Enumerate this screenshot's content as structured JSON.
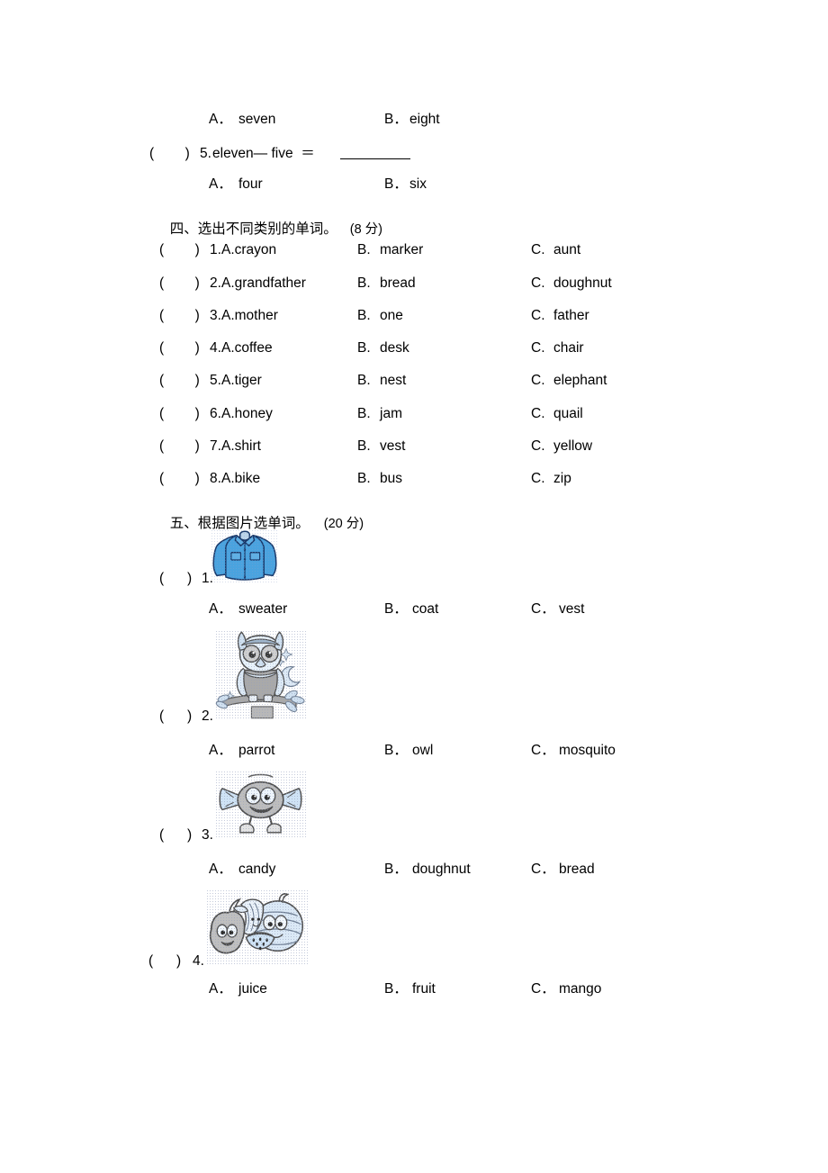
{
  "document": {
    "type": "english-exam-worksheet",
    "page_background": "#ffffff"
  },
  "carryover_question": {
    "options": {
      "a_label": "A．",
      "a_text": "seven",
      "b_label": "B．",
      "b_text": "eight"
    }
  },
  "question_5": {
    "paren": "(        )",
    "number": "5.",
    "stem": "eleven— five  ＝",
    "options": {
      "a_label": "A．",
      "a_text": "four",
      "b_label": "B．",
      "b_text": "six"
    }
  },
  "section_four": {
    "heading_cn": "四、选出不同类别的单词。",
    "score": "(8 分)",
    "paren": "(        )",
    "items": [
      {
        "num": "1.",
        "a": "A.crayon",
        "b_label": "B.",
        "b": "marker",
        "c_label": "C.",
        "c": "aunt"
      },
      {
        "num": "2.",
        "a": "A.grandfather",
        "b_label": "B.",
        "b": "bread",
        "c_label": "C.",
        "c": "doughnut"
      },
      {
        "num": "3.",
        "a": "A.mother",
        "b_label": "B.",
        "b": "one",
        "c_label": "C.",
        "c": "father"
      },
      {
        "num": "4.",
        "a": "A.coffee",
        "b_label": "B.",
        "b": "desk",
        "c_label": "C.",
        "c": "chair"
      },
      {
        "num": "5.",
        "a": "A.tiger",
        "b_label": "B.",
        "b": "nest",
        "c_label": "C.",
        "c": "elephant"
      },
      {
        "num": "6.",
        "a": "A.honey",
        "b_label": "B.",
        "b": "jam",
        "c_label": "C.",
        "c": "quail"
      },
      {
        "num": "7.",
        "a": "A.shirt",
        "b_label": "B.",
        "b": "vest",
        "c_label": "C.",
        "c": "yellow"
      },
      {
        "num": "8.",
        "a": "A.bike",
        "b_label": "B.",
        "b": "bus",
        "c_label": "C.",
        "c": "zip"
      }
    ]
  },
  "section_five": {
    "heading_cn": "五、根据图片选单词。",
    "score": "(20 分)",
    "paren": "(      )",
    "items": [
      {
        "num": "1.",
        "image_name": "blue-denim-jacket",
        "a_label": "A．",
        "a": "sweater",
        "b_label": "B．",
        "b": "coat",
        "c_label": "C．",
        "c": "vest"
      },
      {
        "num": "2.",
        "image_name": "owl-on-branch-with-moon-and-stars",
        "a_label": "A．",
        "a": "parrot",
        "b_label": "B．",
        "b": "owl",
        "c_label": "C．",
        "c": "mosquito"
      },
      {
        "num": "3.",
        "image_name": "cartoon-candy-with-face-and-legs",
        "a_label": "A．",
        "a": "candy",
        "b_label": "B．",
        "b": "doughnut",
        "c_label": "C．",
        "c": "bread"
      },
      {
        "num": "4.",
        "image_name": "group-of-cartoon-fruits",
        "a_label": "A．",
        "a": "juice",
        "b_label": "B．",
        "b": "fruit",
        "c_label": "C．",
        "c": "mango"
      }
    ]
  },
  "colors": {
    "text": "#000000",
    "jacket_blue": "#4aa3df",
    "jacket_outline": "#1a3a6b",
    "clipart_blue": "#bcd4ea",
    "clipart_gray": "#a9a9a9"
  }
}
